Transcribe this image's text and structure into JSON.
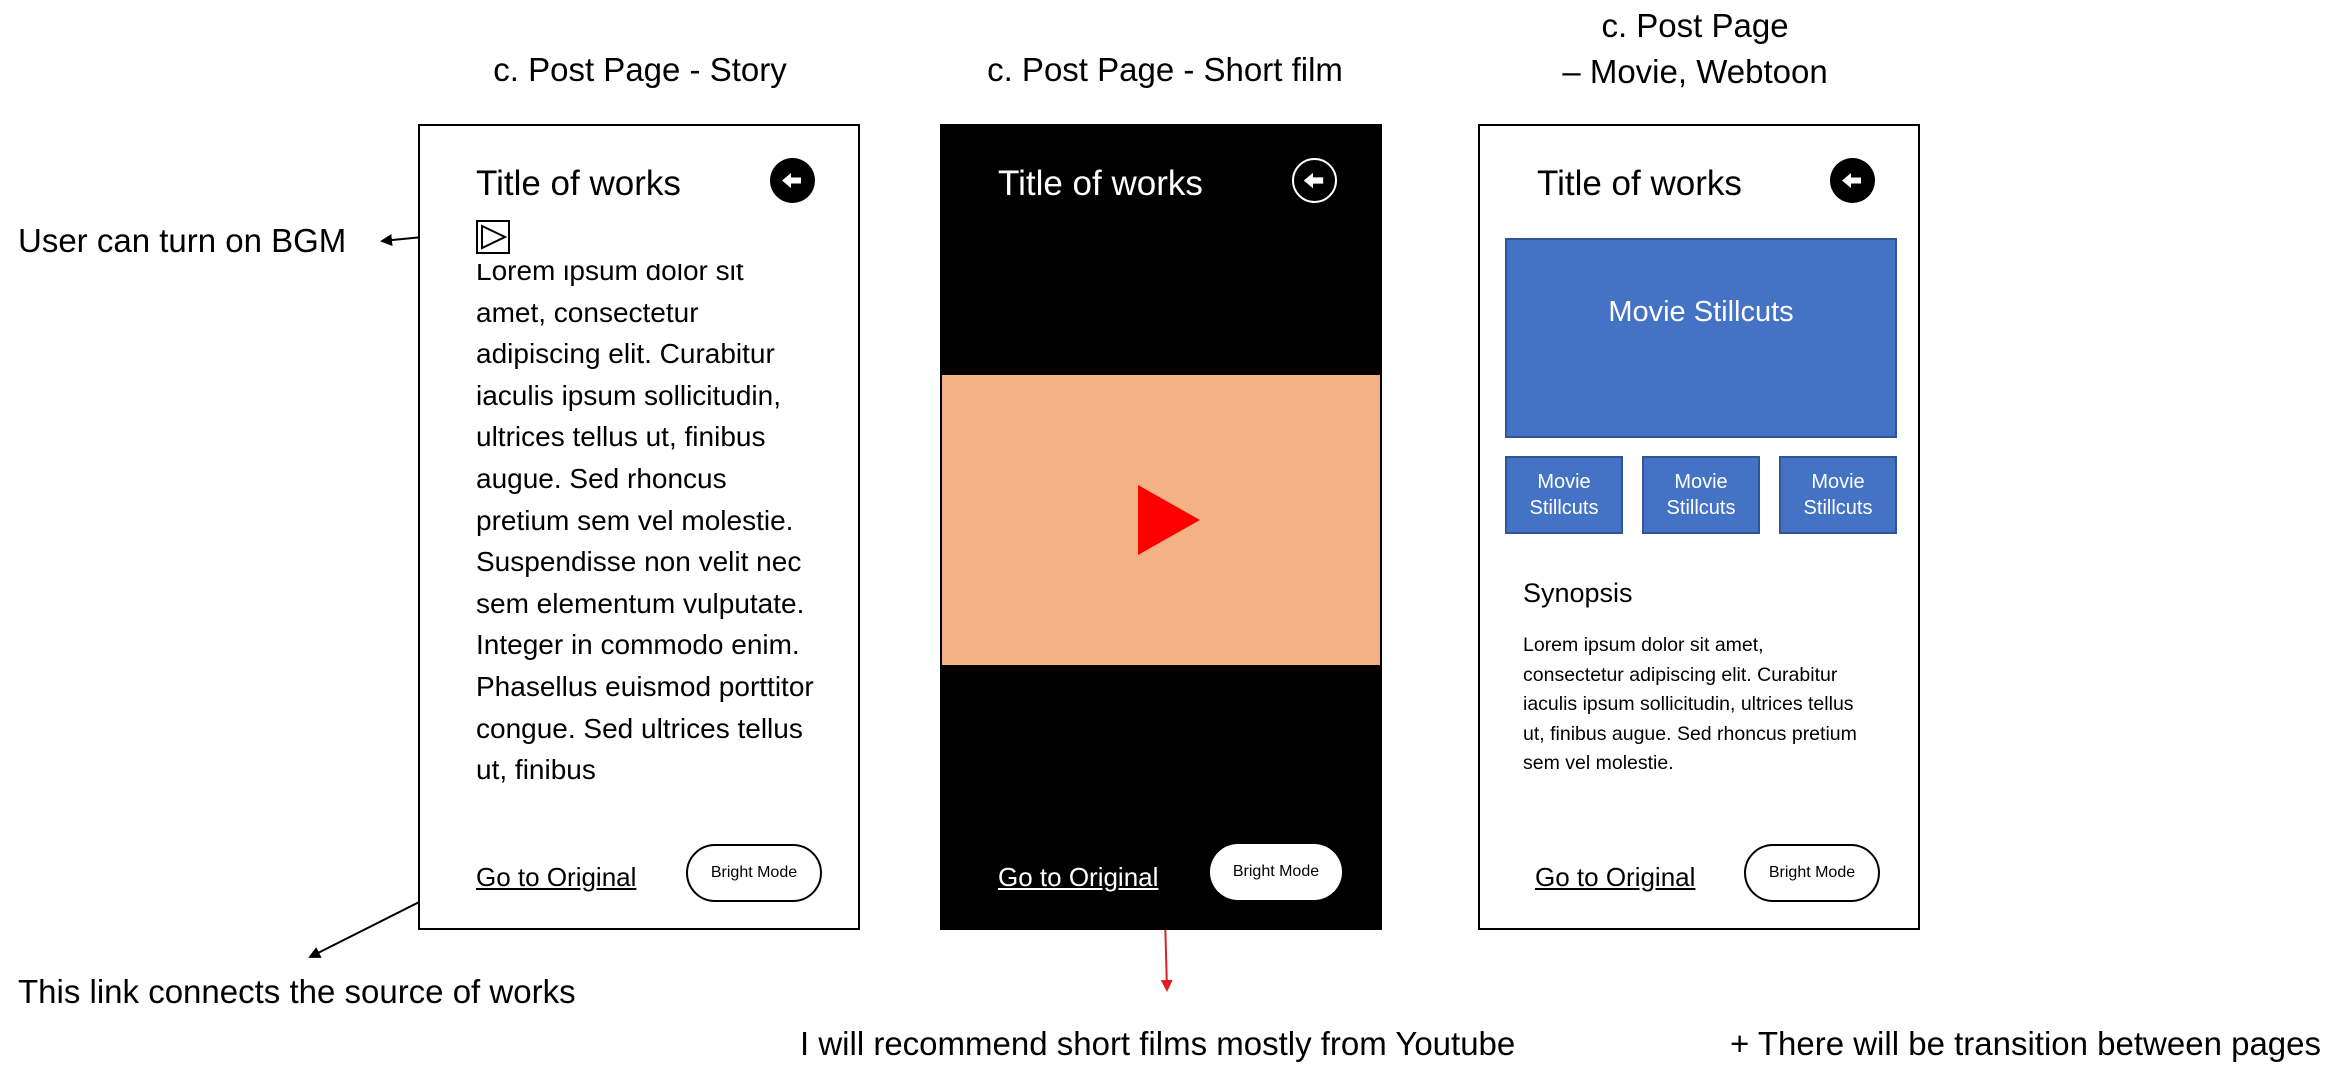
{
  "headings": {
    "story": "c. Post Page - Story",
    "short_film": "c. Post Page - Short film",
    "movie_line1": "c. Post Page",
    "movie_line2": "– Movie, Webtoon"
  },
  "notes": {
    "bgm": "User can turn on BGM",
    "link": "This link connects the source of works",
    "youtube": "I will recommend short films mostly from Youtube",
    "transition": "+ There will be transition between pages"
  },
  "story_page": {
    "title": "Title of works",
    "body": "Lorem ipsum dolor sit amet, consectetur adipiscing elit. Curabitur iaculis ipsum sollicitudin, ultrices tellus ut, finibus augue. Sed rhoncus pretium sem vel molestie. Suspendisse non velit nec sem elementum vulputate. Integer in commodo enim. Phasellus euismod porttitor congue. Sed ultrices tellus ut, finibus",
    "link": "Go to Original",
    "bright_mode": "Bright Mode"
  },
  "short_film_page": {
    "title": "Title of works",
    "link": "Go to Original",
    "bright_mode": "Bright Mode"
  },
  "movie_page": {
    "title": "Title of works",
    "main_still": "Movie Stillcuts",
    "small_stills": [
      "Movie Stillcuts",
      "Movie Stillcuts",
      "Movie Stillcuts"
    ],
    "synopsis_title": "Synopsis",
    "synopsis_text": "Lorem ipsum dolor sit amet, consectetur adipiscing elit. Curabitur iaculis ipsum sollicitudin, ultrices tellus ut, finibus augue. Sed rhoncus pretium sem vel molestie.",
    "link": "Go to Original",
    "bright_mode": "Bright Mode"
  },
  "icons": {
    "back": "back-arrow-icon",
    "bgm": "play-square-icon",
    "video_play": "play-triangle-icon"
  },
  "colors": {
    "video_bg": "#f4b183",
    "play_red": "#ff0000",
    "stillcut_blue": "#4472c4",
    "annotation_red": "#e02020"
  }
}
